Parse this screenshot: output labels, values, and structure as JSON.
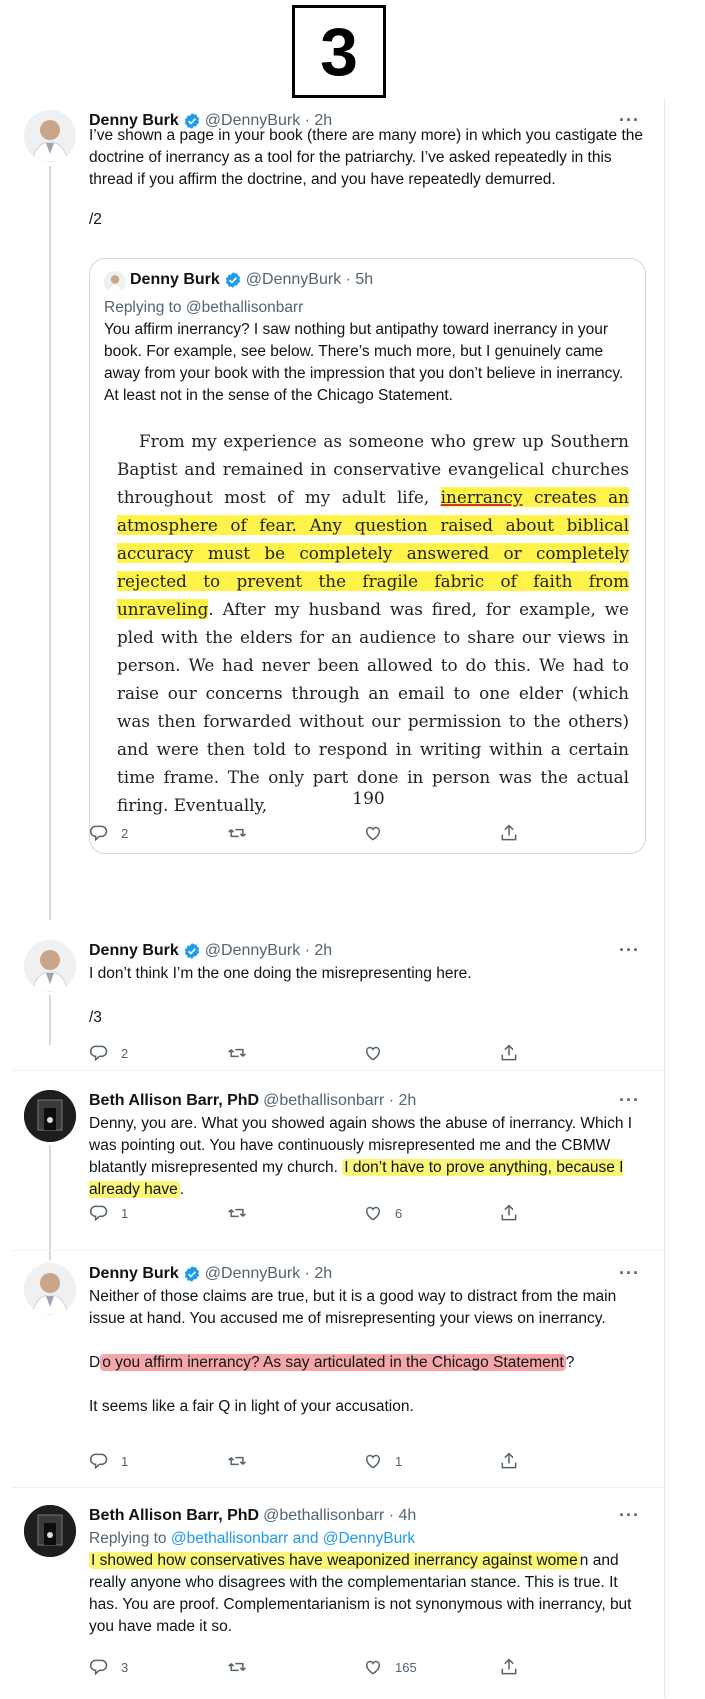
{
  "page_number": "3",
  "colors": {
    "accent": "#1d9bf0",
    "highlight_yellow": "#fbf676",
    "highlight_red": "#f5a6a8",
    "muted": "#536471"
  },
  "icons": [
    "verified-badge-icon",
    "more-icon",
    "reply-icon",
    "retweet-icon",
    "like-icon",
    "share-icon"
  ],
  "tweets": [
    {
      "name": "Denny Burk",
      "handle": "@DennyBurk · 2h",
      "text": "I’ve shown a page in your book (there are many more) in which you castigate the doctrine of inerrancy as a tool for the patriarchy. I’ve asked repeatedly in this thread if you affirm the doctrine, and you have repeatedly demurred.",
      "suffix": "/2",
      "quote": {
        "name": "Denny Burk",
        "handle": "@DennyBurk · 5h",
        "replying": "Replying to @bethallisonbarr",
        "text": "You affirm inerrancy? I saw nothing but antipathy toward inerrancy in your book. For example, see below. There’s much more, but I genuinely came away from your book with the impression that you don’t believe in inerrancy. At least not in the sense of the Chicago Statement.",
        "book": {
          "pre": "From my experience as someone who grew up Southern Baptist and remained in conservative evangelical churches throughout most of my adult life,",
          "underlined": "inerrancy",
          "highlighted": "creates an atmosphere of fear. Any question raised about biblical accuracy must be completely answered or completely rejected to prevent the fragile fabric of faith from unraveling",
          "post": ". After my husband was fired, for example, we pled with the elders for an audience to share our views in person. We had never been allowed to do this. We had to raise our concerns through an email to one elder (which was then forwarded without our permission to the others) and were then told to respond in writing within a certain time frame. The only part done in person was the actual firing. Eventually,",
          "page": "190"
        }
      },
      "replies": "2",
      "retweets": "",
      "likes": ""
    },
    {
      "name": "Denny Burk",
      "handle": "@DennyBurk · 2h",
      "text": "I don’t think I’m the one doing the misrepresenting here.",
      "suffix": "/3",
      "replies": "2",
      "retweets": "",
      "likes": ""
    },
    {
      "name": "Beth Allison Barr, PhD",
      "handle": "@bethallisonbarr · 2h",
      "text_pre": "Denny, you are. What you showed again shows the abuse of inerrancy. Which I was pointing out. You have continuously misrepresented me and the CBMW blatantly misrepresented my church.",
      "text_hl": "I don’t have to prove anything, because I already have",
      "text_post": ".",
      "replies": "1",
      "retweets": "",
      "likes": "6"
    },
    {
      "name": "Denny Burk",
      "handle": "@DennyBurk · 2h",
      "text": "Neither of those claims are true, but it is a good way to distract from the main issue at hand. You accused me of misrepresenting your views on inerrancy.",
      "q_pre": "D",
      "q_hl": "o you affirm inerrancy? As say articulated in the Chicago Statement",
      "q_post": "?",
      "text2": "It seems like a fair Q in light of your accusation.",
      "replies": "1",
      "retweets": "",
      "likes": "1"
    },
    {
      "name": "Beth Allison Barr, PhD",
      "handle": "@bethallisonbarr · 4h",
      "replying_pre": "Replying to ",
      "replying_link": "@bethallisonbarr and @DennyBurk",
      "text_hl": "I showed how conservatives have weaponized inerrancy against wome",
      "text_post": "n and really anyone who disagrees with the complementarian stance. This is true. It has. You are proof. Complementarianism is not synonymous with inerrancy, but you have made it so.",
      "replies": "3",
      "retweets": "",
      "likes": "165"
    }
  ]
}
